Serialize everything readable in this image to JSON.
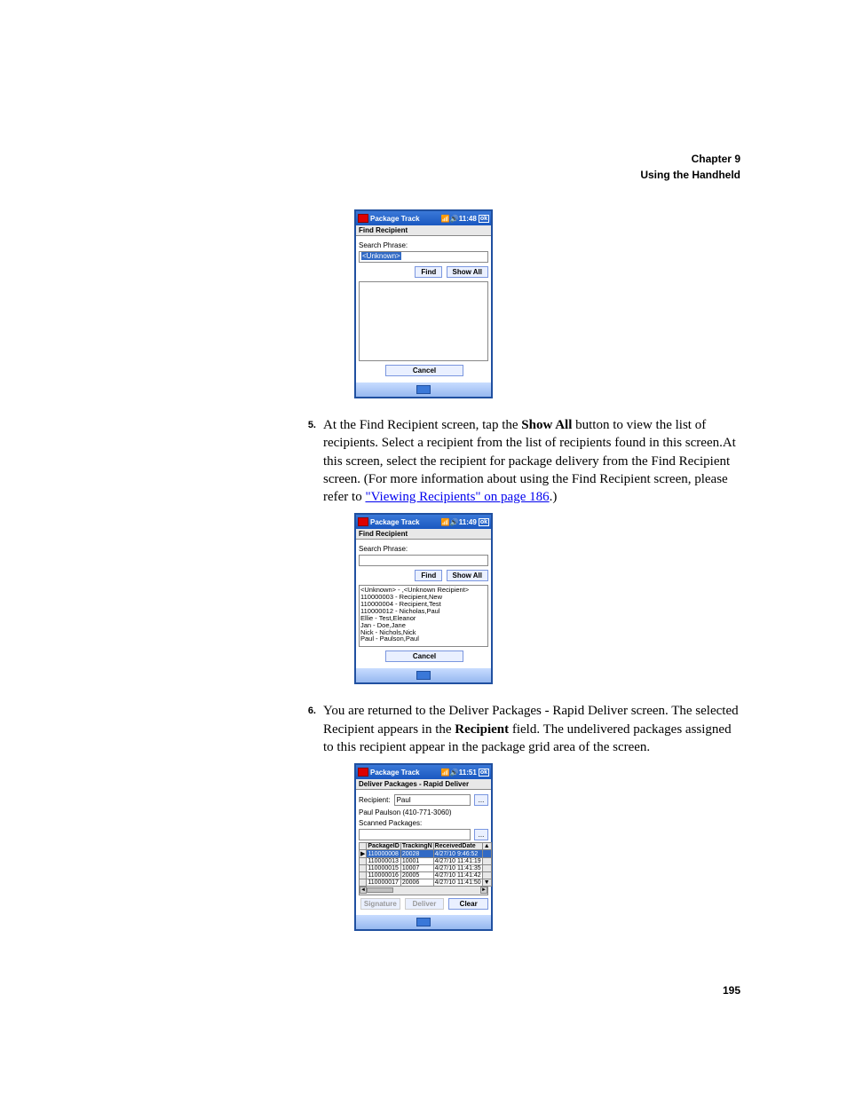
{
  "header": {
    "chapter": "Chapter 9",
    "title": "Using the Handheld"
  },
  "step5": {
    "num": "5.",
    "t1": "At the Find Recipient screen, tap the ",
    "b1": "Show All",
    "t2": " button to view the list of recipients. Select a recipient from the list of recipients found in this screen.At this screen, select the recipient for package delivery from the Find Recipient screen. (For more information about using the Find Recipient screen, please refer to ",
    "link": "\"Viewing Recipients\" on page 186",
    "t3": ".)"
  },
  "step6": {
    "num": "6.",
    "t1": "You are returned to the Deliver Packages - Rapid Deliver screen. The selected Recipient appears in the ",
    "b1": "Recipient",
    "t2": " field. The undelivered packages assigned to this recipient appear in the package grid area of the screen."
  },
  "dev1": {
    "appTitle": "Package Track",
    "time": "11:48",
    "screen": "Find Recipient",
    "searchLabel": "Search Phrase:",
    "inputValue": "<Unknown>",
    "findBtn": "Find",
    "showAllBtn": "Show All",
    "cancelBtn": "Cancel"
  },
  "dev2": {
    "appTitle": "Package Track",
    "time": "11:49",
    "screen": "Find Recipient",
    "searchLabel": "Search Phrase:",
    "findBtn": "Find",
    "showAllBtn": "Show All",
    "cancelBtn": "Cancel",
    "items": [
      "<Unknown> - ,<Unknown Recipient>",
      "110000003 - Recipient,New",
      "110000004 - Recipient,Test",
      "110000012 - Nicholas,Paul",
      "Ellie - Test,Eleanor",
      "Jan - Doe,Jane",
      "Nick - Nichols,Nick",
      "Paul - Paulson,Paul"
    ]
  },
  "dev3": {
    "appTitle": "Package Track",
    "time": "11:51",
    "screen": "Deliver Packages - Rapid Deliver",
    "recipLabel": "Recipient:",
    "recipValue": "Paul",
    "recipFull": "Paul Paulson (410-771-3060)",
    "scannedLabel": "Scanned Packages:",
    "cols": [
      "PackageID",
      "TrackingN",
      "ReceivedDate"
    ],
    "rows": [
      [
        "110000008",
        "20028",
        "4/27/10 9:46:52"
      ],
      [
        "110000013",
        "10001",
        "4/27/10 11:41:19"
      ],
      [
        "110000015",
        "10007",
        "4/27/10 11:41:35"
      ],
      [
        "110000016",
        "20005",
        "4/27/10 11:41:42"
      ],
      [
        "110000017",
        "20006",
        "4/27/10 11:41:50"
      ]
    ],
    "sigBtn": "Signature",
    "delBtn": "Deliver",
    "clearBtn": "Clear"
  },
  "pageNum": "195"
}
